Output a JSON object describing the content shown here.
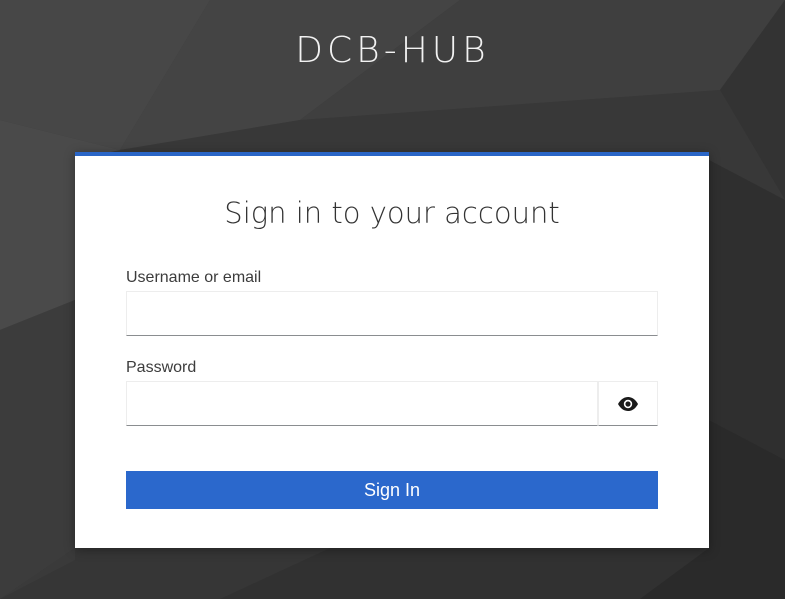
{
  "brand": {
    "title": "DCB-HUB"
  },
  "login_card": {
    "title": "Sign in to your account",
    "accent_color": "#2a66c7",
    "username": {
      "label": "Username or email",
      "value": "",
      "placeholder": ""
    },
    "password": {
      "label": "Password",
      "value": "",
      "placeholder": "",
      "toggle_icon": "eye-icon"
    },
    "submit": {
      "label": "Sign In",
      "color": "#2b68cc"
    }
  }
}
